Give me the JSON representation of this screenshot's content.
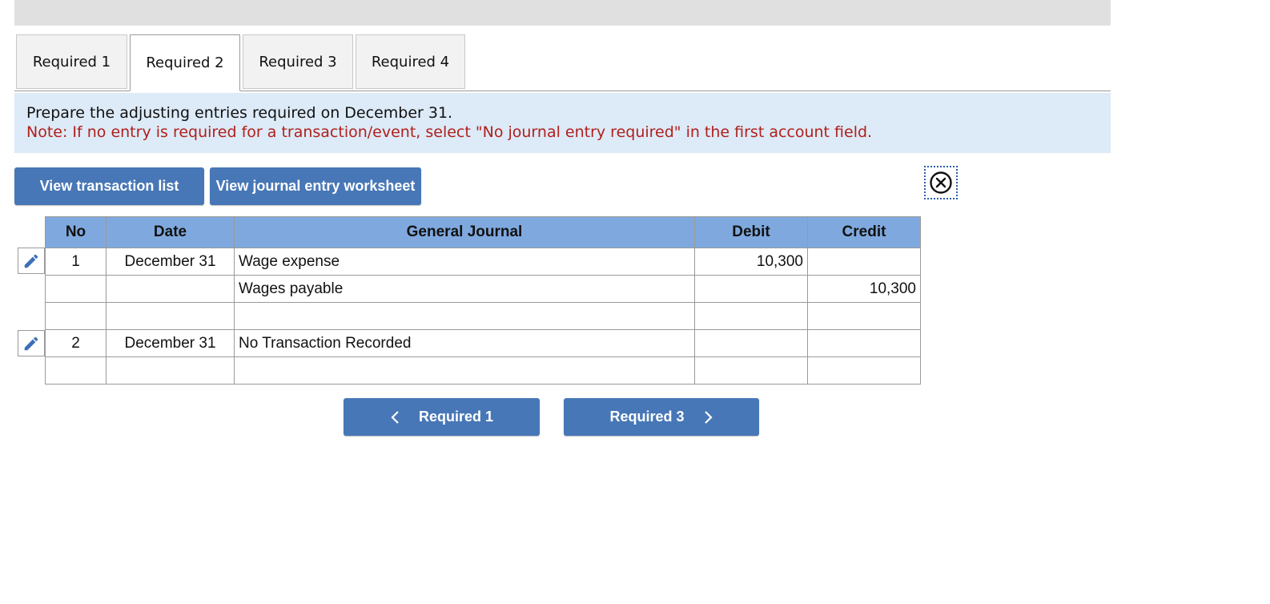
{
  "tabs": [
    {
      "label": "Required 1"
    },
    {
      "label": "Required 2",
      "active": true
    },
    {
      "label": "Required 3"
    },
    {
      "label": "Required 4"
    }
  ],
  "instructions": {
    "line1": "Prepare the adjusting entries required on December 31.",
    "note": "Note: If no entry is required for a transaction/event, select \"No journal entry required\" in the first account field."
  },
  "buttons": {
    "view_transaction_list": "View transaction list",
    "view_journal_entry_worksheet": "View journal entry worksheet"
  },
  "table": {
    "headers": [
      "No",
      "Date",
      "General Journal",
      "Debit",
      "Credit"
    ],
    "rows": [
      {
        "no": "1",
        "date": "December 31",
        "account": "Wage expense",
        "debit": "10,300",
        "credit": ""
      },
      {
        "no": "",
        "date": "",
        "account": "Wages payable",
        "debit": "",
        "credit": "10,300"
      },
      {
        "no": "",
        "date": "",
        "account": "",
        "debit": "",
        "credit": ""
      },
      {
        "no": "2",
        "date": "December 31",
        "account": "No Transaction Recorded",
        "debit": "",
        "credit": ""
      },
      {
        "no": "",
        "date": "",
        "account": "",
        "debit": "",
        "credit": ""
      }
    ]
  },
  "nav": {
    "prev_label": "Required 1",
    "next_label": "Required 3"
  },
  "icons": {
    "edit": "pencil-icon",
    "close": "close-circle-icon",
    "prev": "chevron-left-icon",
    "next": "chevron-right-icon"
  },
  "colors": {
    "accent": "#4777b6",
    "header": "#7fa9de",
    "instruction_bg": "#ddeaf7",
    "note": "#b0201c"
  }
}
